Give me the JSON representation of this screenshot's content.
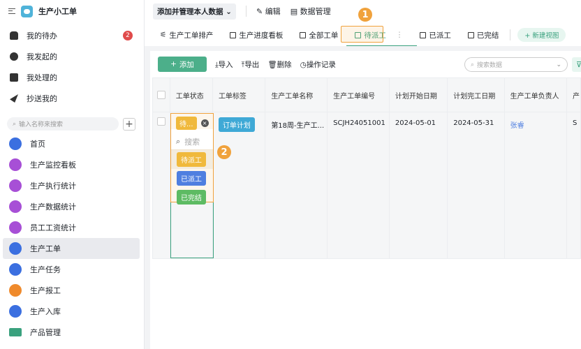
{
  "app": {
    "title": "生产小工单"
  },
  "sidebar": {
    "quick": [
      {
        "label": "我的待办",
        "icon": "bell-icon",
        "badge": "2"
      },
      {
        "label": "我发起的",
        "icon": "play-icon"
      },
      {
        "label": "我处理的",
        "icon": "inbox-check-icon"
      },
      {
        "label": "抄送我的",
        "icon": "send-icon"
      }
    ],
    "search_placeholder": "输入名称来搜索",
    "nav": [
      {
        "label": "首页",
        "color": "#3b6fe0"
      },
      {
        "label": "生产监控看板",
        "color": "#a74fd6"
      },
      {
        "label": "生产执行统计",
        "color": "#a74fd6"
      },
      {
        "label": "生产数据统计",
        "color": "#a74fd6"
      },
      {
        "label": "员工工资统计",
        "color": "#a74fd6"
      },
      {
        "label": "生产工单",
        "color": "#3b6fe0",
        "active": true
      },
      {
        "label": "生产任务",
        "color": "#3b6fe0"
      },
      {
        "label": "生产报工",
        "color": "#ef8a2c"
      },
      {
        "label": "生产入库",
        "color": "#3b6fe0"
      },
      {
        "label": "产品管理",
        "color": "#3aa17e"
      }
    ]
  },
  "topbar": {
    "dataset": "添加并管理本人数据",
    "edit": "编辑",
    "manage": "数据管理"
  },
  "tabs": [
    "生产工单排产",
    "生产进度看板",
    "全部工单",
    "待派工",
    "已派工",
    "已完结"
  ],
  "new_view": "新建视图",
  "toolbar": {
    "add": "添加",
    "import": "导入",
    "export": "导出",
    "delete": "删除",
    "log": "操作记录",
    "search_placeholder": "搜索数据"
  },
  "table": {
    "headers": [
      "工单状态",
      "工单标签",
      "生产工单名称",
      "生产工单编号",
      "计划开始日期",
      "计划完工日期",
      "生产工单负责人",
      "产"
    ],
    "row": {
      "status": "待...",
      "tag": "订单计划",
      "name": "第18周-生产工...",
      "code": "SCJH24051001",
      "start": "2024-05-01",
      "end": "2024-05-31",
      "owner": "张睿",
      "last": "S"
    }
  },
  "dropdown": {
    "search_placeholder": "搜索",
    "options": [
      {
        "label": "待派工",
        "color": "#f0b93c"
      },
      {
        "label": "已派工",
        "color": "#4f7fe0"
      },
      {
        "label": "已完结",
        "color": "#5dbb63"
      }
    ]
  },
  "markers": [
    "1",
    "2"
  ],
  "colors": {
    "accent": "#3aa17e",
    "highlight": "#f0a23c"
  }
}
